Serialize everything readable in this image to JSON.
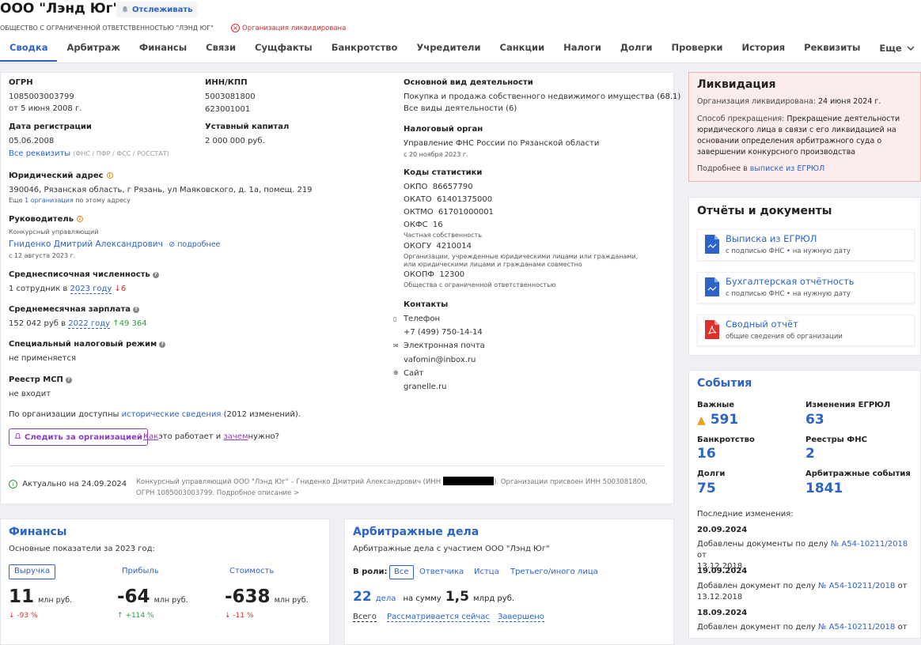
{
  "header": {
    "company_name": "ООО \"Лэнд Юг\"",
    "track_label": "Отслеживать",
    "full_name": "ОБЩЕСТВО С ОГРАНИЧЕННОЙ ОТВЕТСТВЕННОСТЬЮ \"ЛЭНД ЮГ\"",
    "status_badge": "Организация ликвидирована"
  },
  "tabs": [
    "Сводка",
    "Арбитраж",
    "Финансы",
    "Связи",
    "Сущфакты",
    "Банкротство",
    "Учредители",
    "Санкции",
    "Налоги",
    "Долги",
    "Проверки",
    "История",
    "Реквизиты",
    "Еще"
  ],
  "summary": {
    "ogrn_label": "ОГРН",
    "ogrn": "1085003003799",
    "ogrn_date": "от 5 июня 2008 г.",
    "inn_label": "ИНН/КПП",
    "inn": "5003081800",
    "kpp": "623001001",
    "reg_date_label": "Дата регистрации",
    "reg_date": "05.06.2008",
    "all_requisites": "Все реквизиты",
    "requisites_note": "(ФНС / ПФР / ФСС / РОССТАТ)",
    "capital_label": "Уставный капитал",
    "capital": "2 000 000 руб.",
    "address_label": "Юридический адрес",
    "address": "390046, Рязанская область, г Рязань, ул Маяковского, д. 1а, помещ. 219",
    "address_more_prefix": "Еще",
    "address_more_link": "1 организация",
    "address_more_suffix": "по этому адресу",
    "head_label": "Руководитель",
    "head_role": "Конкурсный управляющий",
    "head_name": "Гниденко Дмитрий Александрович",
    "head_more": "подробнее",
    "head_since": "с 12 августа 2023 г.",
    "employees_label": "Среднесписочная численность",
    "employees_prefix": "1 сотрудник в",
    "employees_year": "2023 году",
    "employees_change": "↓6",
    "salary_label": "Среднемесячная зарплата",
    "salary_prefix": "152 042 руб в",
    "salary_year": "2022 году",
    "salary_change": "↑49 364",
    "tax_regime_label": "Специальный налоговый режим",
    "tax_regime": "не применяется",
    "msp_label": "Реестр МСП",
    "msp": "не входит",
    "history_prefix": "По организации доступны",
    "history_link": "исторические сведения",
    "history_suffix": "(2012 изменений).",
    "follow_btn": "Следить за организацией",
    "how_link": "Как",
    "how_text": "это работает и",
    "why_link": "зачем",
    "why_text": "нужно?",
    "actual_label": "Актуально на 24.09.2024",
    "footer_note_1": "Конкурсный управляющий ООО \"Лэнд Юг\" – Гниденко Дмитрий Александрович (ИНН",
    "footer_note_2": "). Организации присвоен ИНН 5003081800,",
    "footer_note_3": "ОГРН 1085003003799. Подробное описание >"
  },
  "activity": {
    "label": "Основной вид деятельности",
    "value": "Покупка и продажа собственного недвижимого имущества",
    "code": "(68.1)",
    "all_link": "Все виды деятельности (6)",
    "tax_label": "Налоговый орган",
    "tax_value": "Управление ФНС России по Рязанской области",
    "tax_since": "с 20 ноября 2023 г.",
    "codes_label": "Коды статистики",
    "okpo": "ОКПО  86657790",
    "okato": "ОКАТО  61401375000",
    "oktmo": "ОКТМО  61701000001",
    "okfs": "ОКФС  16",
    "okfs_note": "Частная собственность",
    "okogu": "ОКОГУ  4210014",
    "okogu_note": "Организации, учрежденные юридическими лицами или гражданами, или юридическими лицами и гражданами совместно",
    "okopf": "ОКОПФ  12300",
    "okopf_note": "Общества с ограниченной ответственностью",
    "contacts_label": "Контакты",
    "phone_label": "Телефон",
    "phone": "+7 (499) 750-14-14",
    "email_label": "Электронная почта",
    "email": "vafomin@inbox.ru",
    "site_label": "Сайт",
    "site": "granelle.ru"
  },
  "liquidation": {
    "title": "Ликвидация",
    "date_label": "Организация ликвидирована:",
    "date": "24 июня 2024 г.",
    "method_label": "Способ прекращения:",
    "method": "Прекращение деятельности юридического лица в связи с его ликвидацией на основании определения арбитражного суда о завершении конкурсного производства",
    "more_prefix": "Подробнее в",
    "more_link": "выписке из ЕГРЮЛ"
  },
  "documents": {
    "title": "Отчёты и документы",
    "items": [
      {
        "title": "Выписка из ЕГРЮЛ",
        "sub": "с подписью ФНС • на нужную дату",
        "icon": "document-icon"
      },
      {
        "title": "Бухгалтерская отчётность",
        "sub": "с подписью ФНС • на нужную дату",
        "icon": "document-icon"
      },
      {
        "title": "Сводный отчёт",
        "sub": "общие сведения об организации",
        "icon": "pdf-icon"
      }
    ]
  },
  "events": {
    "title": "События",
    "important_label": "Важные",
    "important": "591",
    "egrul_label": "Изменения ЕГРЮЛ",
    "egrul": "63",
    "bankruptcy_label": "Банкротство",
    "bankruptcy": "16",
    "fns_label": "Реестры ФНС",
    "fns": "2",
    "debts_label": "Долги",
    "debts": "75",
    "arbitration_label": "Арбитражные события",
    "arbitration": "1841",
    "recent_label": "Последние изменения:",
    "recent": [
      {
        "date": "20.09.2024",
        "prefix": "Добавлены документы по делу",
        "link": "№ А54-10211/2018",
        "suffix": "от",
        "tail": "13.12.2018"
      },
      {
        "date": "19.09.2024",
        "prefix": "Добавлен документ по делу",
        "link": "№ А54-10211/2018",
        "suffix": "от",
        "tail": "13.12.2018"
      },
      {
        "date": "18.09.2024",
        "prefix": "Добавлен документ по делу",
        "link": "№ А54-10211/2018",
        "suffix": "от",
        "tail": ""
      }
    ]
  },
  "finances": {
    "title": "Финансы",
    "subtitle": "Основные показатели за 2023 год:",
    "revenue_label": "Выручка",
    "revenue": "11",
    "revenue_unit": "млн руб.",
    "revenue_change": "↓ -93 %",
    "profit_label": "Прибыль",
    "profit": "-64",
    "profit_unit": "млн руб.",
    "profit_change": "↑ +114 %",
    "value_label": "Стоимость",
    "value": "-638",
    "value_unit": "млн руб.",
    "value_change": "↓ -11 %"
  },
  "arbitration": {
    "title": "Арбитражные дела",
    "subtitle": "Арбитражные дела с участием ООО \"Лэнд Юг\"",
    "role_label": "В роли:",
    "roles": [
      "Все",
      "Ответчика",
      "Истца",
      "Третьего/иного лица"
    ],
    "cases_count": "22",
    "cases_word": "дела",
    "sum_prefix": "на сумму",
    "sum": "1,5",
    "sum_unit": "млрд руб.",
    "filters": [
      "Всего",
      "Рассматривается сейчас",
      "Завершено"
    ]
  }
}
